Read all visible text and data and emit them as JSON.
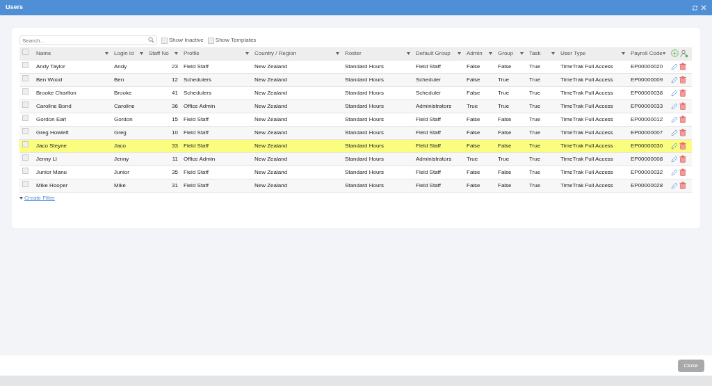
{
  "window": {
    "title": "Users"
  },
  "toolbar": {
    "search": {
      "placeholder": "Search..."
    },
    "options": [
      {
        "label": "Show Inactive",
        "checked": false
      },
      {
        "label": "Show Templates",
        "checked": false
      }
    ]
  },
  "table": {
    "select_all": {
      "checked": false
    },
    "columns": [
      {
        "label": "Name"
      },
      {
        "label": "Login Id"
      },
      {
        "label": "Staff No"
      },
      {
        "label": "Profile"
      },
      {
        "label": "Country / Region"
      },
      {
        "label": "Roster"
      },
      {
        "label": "Default Group"
      },
      {
        "label": "Admin"
      },
      {
        "label": "Group"
      },
      {
        "label": "Task"
      },
      {
        "label": "User Type"
      },
      {
        "label": "Payroll Code"
      }
    ],
    "rows": [
      {
        "selected": false,
        "checked": false,
        "cells": [
          "Andy Taylor",
          "Andy",
          "23",
          "Field Staff",
          "New Zealand",
          "Standard Hours",
          "Field Staff",
          "False",
          "False",
          "True",
          "TimeTrak Full Access",
          "EP00000020"
        ]
      },
      {
        "selected": false,
        "checked": false,
        "cells": [
          "Ben Wood",
          "Ben",
          "12",
          "Schedulers",
          "New Zealand",
          "Standard Hours",
          "Scheduler",
          "False",
          "True",
          "True",
          "TimeTrak Full Access",
          "EP00000009"
        ]
      },
      {
        "selected": false,
        "checked": false,
        "cells": [
          "Brooke Charlton",
          "Brooke",
          "41",
          "Schedulers",
          "New Zealand",
          "Standard Hours",
          "Scheduler",
          "False",
          "True",
          "True",
          "TimeTrak Full Access",
          "EP00000038"
        ]
      },
      {
        "selected": false,
        "checked": false,
        "cells": [
          "Caroline Bond",
          "Caroline",
          "36",
          "Office Admin",
          "New Zealand",
          "Standard Hours",
          "Administrators",
          "True",
          "True",
          "True",
          "TimeTrak Full Access",
          "EP00000033"
        ]
      },
      {
        "selected": false,
        "checked": false,
        "cells": [
          "Gordon Earl",
          "Gordon",
          "15",
          "Field Staff",
          "New Zealand",
          "Standard Hours",
          "Field Staff",
          "False",
          "False",
          "True",
          "TimeTrak Full Access",
          "EP00000012"
        ]
      },
      {
        "selected": false,
        "checked": false,
        "cells": [
          "Greg Howlett",
          "Greg",
          "10",
          "Field Staff",
          "New Zealand",
          "Standard Hours",
          "Field Staff",
          "False",
          "False",
          "True",
          "TimeTrak Full Access",
          "EP00000007"
        ]
      },
      {
        "selected": true,
        "checked": false,
        "cells": [
          "Jaco Steyne",
          "Jaco",
          "33",
          "Field Staff",
          "New Zealand",
          "Standard Hours",
          "Field Staff",
          "False",
          "False",
          "True",
          "TimeTrak Full Access",
          "EP00000030"
        ]
      },
      {
        "selected": false,
        "checked": false,
        "cells": [
          "Jenny Li",
          "Jenny",
          "11",
          "Office Admin",
          "New Zealand",
          "Standard Hours",
          "Administrators",
          "True",
          "True",
          "True",
          "TimeTrak Full Access",
          "EP00000008"
        ]
      },
      {
        "selected": false,
        "checked": false,
        "cells": [
          "Junior Manu",
          "Junior",
          "35",
          "Field Staff",
          "New Zealand",
          "Standard Hours",
          "Field Staff",
          "False",
          "False",
          "True",
          "TimeTrak Full Access",
          "EP00000032"
        ]
      },
      {
        "selected": false,
        "checked": false,
        "cells": [
          "Mike Hooper",
          "Mike",
          "31",
          "Field Staff",
          "New Zealand",
          "Standard Hours",
          "Field Staff",
          "False",
          "False",
          "True",
          "TimeTrak Full Access",
          "EP00000028"
        ]
      }
    ]
  },
  "filter_link": "Create Filter",
  "footer": {
    "buttons": [
      "Close"
    ]
  }
}
